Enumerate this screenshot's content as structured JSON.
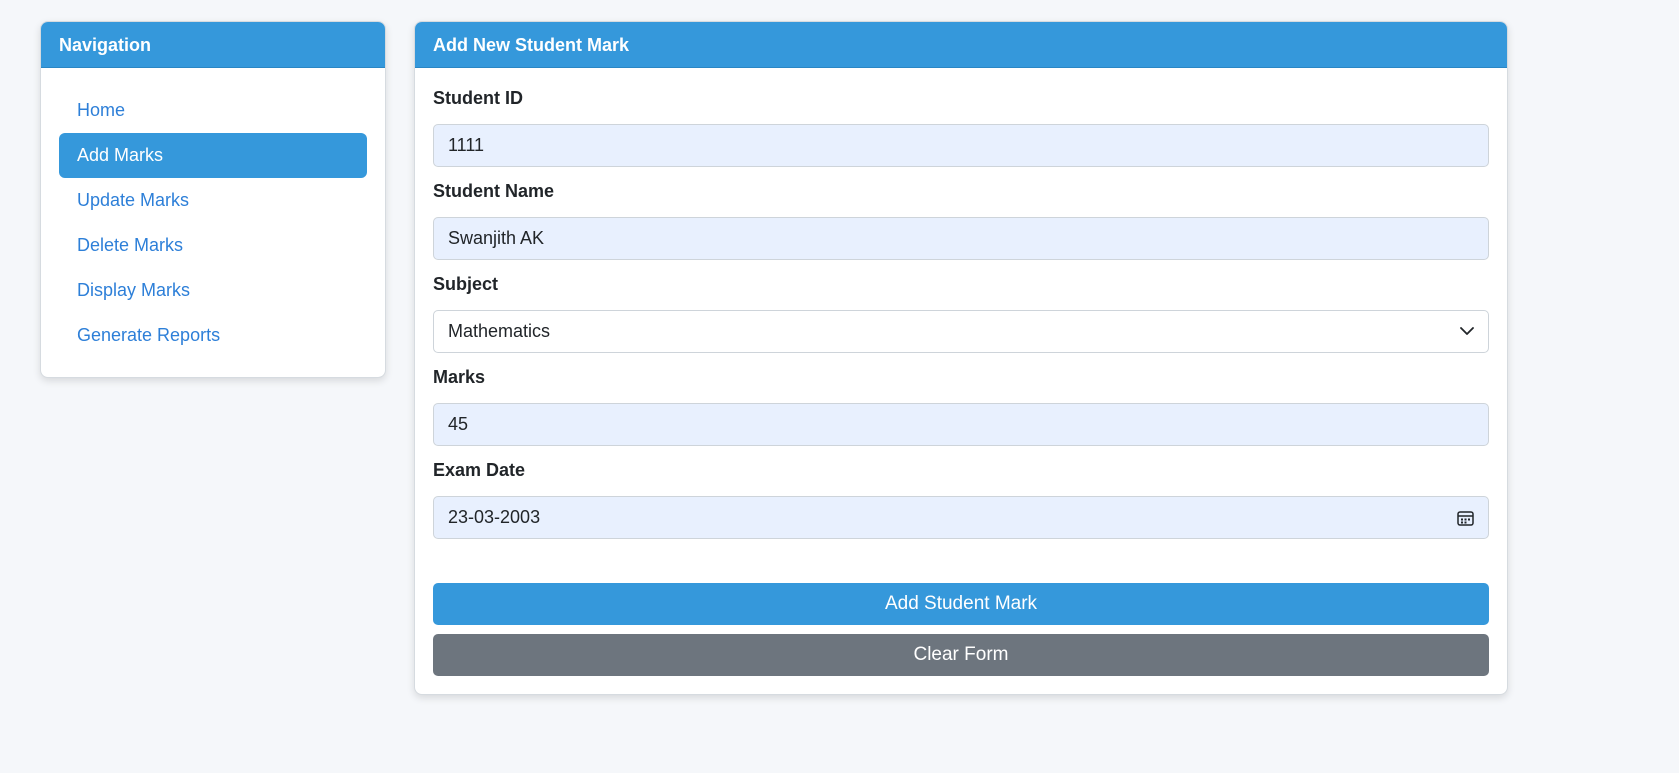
{
  "colors": {
    "accent": "#3598db",
    "link": "#2d7fd8",
    "secondary": "#6d757e",
    "input_fill": "#e8f0fe",
    "background": "#f5f7fa"
  },
  "navigation": {
    "title": "Navigation",
    "items": [
      {
        "label": "Home",
        "active": false
      },
      {
        "label": "Add Marks",
        "active": true
      },
      {
        "label": "Update Marks",
        "active": false
      },
      {
        "label": "Delete Marks",
        "active": false
      },
      {
        "label": "Display Marks",
        "active": false
      },
      {
        "label": "Generate Reports",
        "active": false
      }
    ]
  },
  "form": {
    "title": "Add New Student Mark",
    "student_id": {
      "label": "Student ID",
      "value": "1111"
    },
    "student_name": {
      "label": "Student Name",
      "value": "Swanjith AK"
    },
    "subject": {
      "label": "Subject",
      "value": "Mathematics",
      "icon": "chevron-down-icon"
    },
    "marks": {
      "label": "Marks",
      "value": "45"
    },
    "exam_date": {
      "label": "Exam Date",
      "value": "23-03-2003",
      "icon": "calendar-icon"
    },
    "submit_label": "Add Student Mark",
    "clear_label": "Clear Form"
  }
}
